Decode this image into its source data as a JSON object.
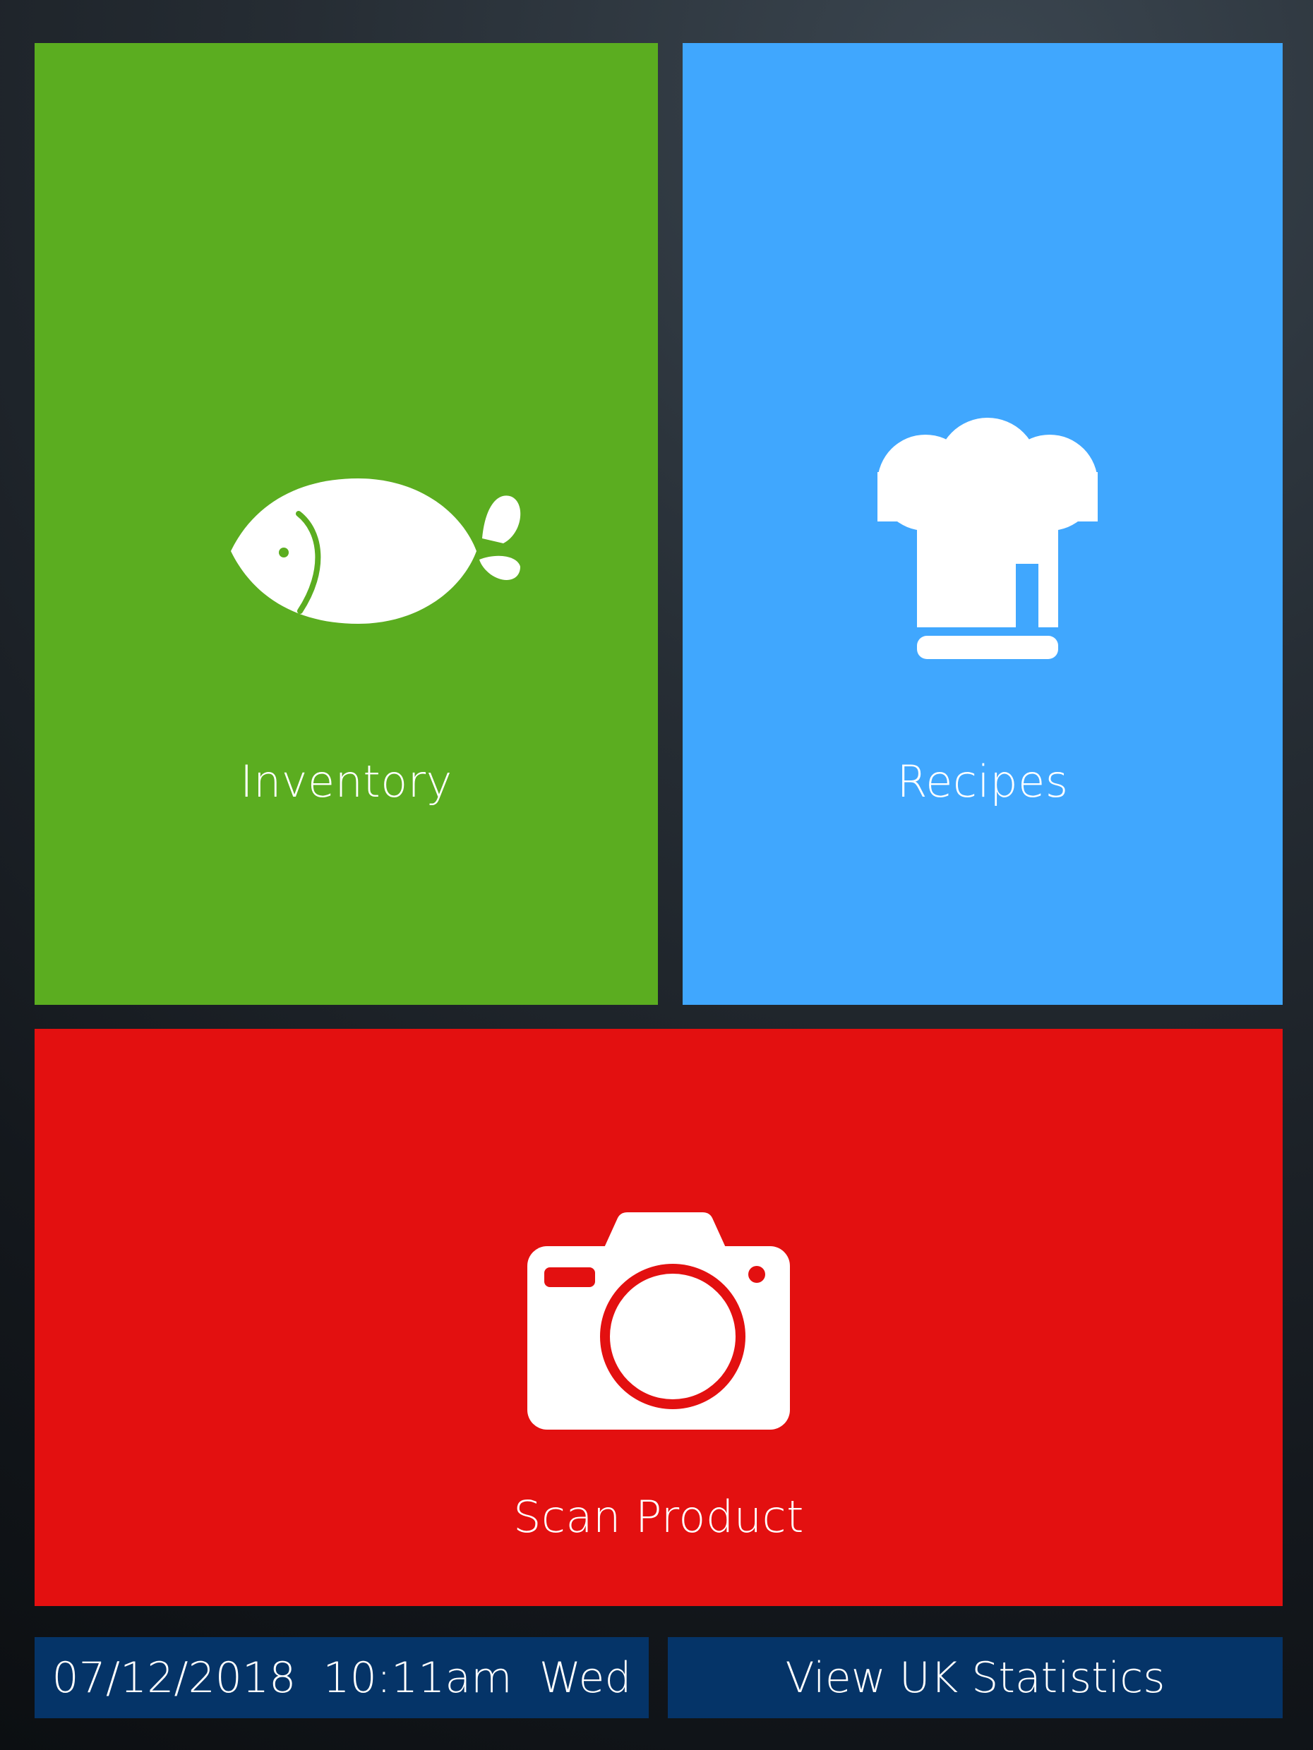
{
  "tiles": {
    "inventory": {
      "label": "Inventory",
      "icon": "fish-icon",
      "color": "#5bad20"
    },
    "recipes": {
      "label": "Recipes",
      "icon": "chef-hat-icon",
      "color": "#40a7fe"
    },
    "scan": {
      "label": "Scan Product",
      "icon": "camera-icon",
      "color": "#e31010"
    }
  },
  "footer": {
    "datetime": "07/12/2018  10:11am  Wed",
    "stats_button_label": "View UK Statistics",
    "bar_color": "#053468"
  }
}
